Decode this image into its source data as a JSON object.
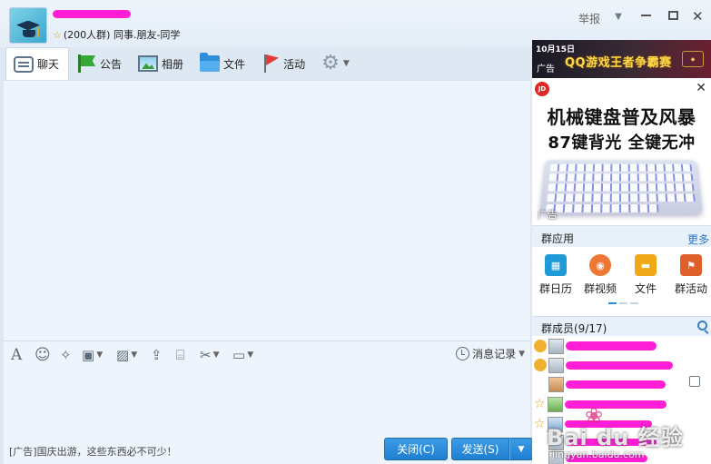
{
  "header": {
    "group_meta": "(200人群) 同事.朋友-同学",
    "report_label": "举报"
  },
  "tabs": [
    {
      "label": "聊天",
      "active": true
    },
    {
      "label": "公告"
    },
    {
      "label": "相册"
    },
    {
      "label": "文件"
    },
    {
      "label": "活动"
    }
  ],
  "toolbar": {
    "message_record_label": "消息记录"
  },
  "bottom": {
    "ad_text": "[广告]国庆出游，这些东西必不可少！",
    "close_button": "关闭(C)",
    "send_button": "发送(S)"
  },
  "ads": {
    "banner_date": "10月15日",
    "banner_label": "广告",
    "banner_title": "QQ游戏王者争霸赛",
    "keyboard_line1": "机械键盘普及风暴",
    "keyboard_line2": "87键背光 全键无冲",
    "keyboard_ad_label": "广告",
    "jd_badge": "JD"
  },
  "apps": {
    "title": "群应用",
    "more": "更多",
    "items": [
      {
        "label": "群日历",
        "color": "#1e9ad6"
      },
      {
        "label": "群视频",
        "color": "#ee7733"
      },
      {
        "label": "文件",
        "color": "#f0a818"
      },
      {
        "label": "群活动",
        "color": "#e0602a"
      }
    ]
  },
  "members": {
    "title": "群成员(9/17)"
  },
  "watermark": {
    "text": "Bai du 经验",
    "url": "jingyan.baidu.com"
  },
  "colors": {
    "accent": "#1f7fd0",
    "link": "#2878c8",
    "scribble": "#ff1ed6"
  }
}
